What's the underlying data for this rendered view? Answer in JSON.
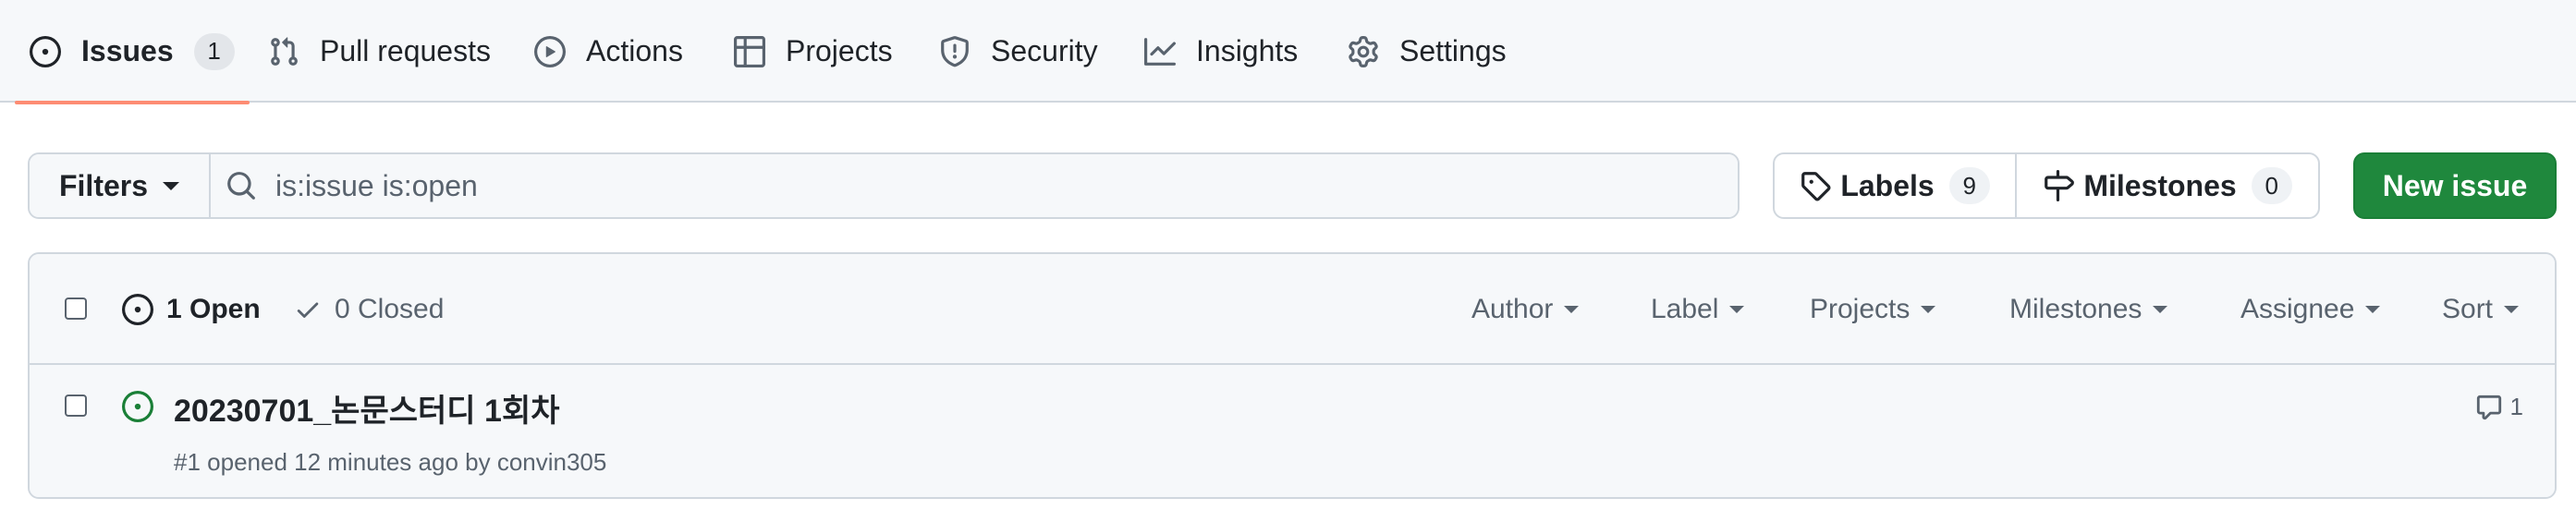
{
  "nav": {
    "issues": {
      "label": "Issues",
      "count": "1"
    },
    "pull_requests": "Pull requests",
    "actions": "Actions",
    "projects": "Projects",
    "security": "Security",
    "insights": "Insights",
    "settings": "Settings"
  },
  "subnav": {
    "filters_label": "Filters",
    "search_value": "is:issue is:open",
    "labels_label": "Labels",
    "labels_count": "9",
    "milestones_label": "Milestones",
    "milestones_count": "0",
    "new_issue_label": "New issue"
  },
  "list_header": {
    "open_label": "1 Open",
    "closed_label": "0 Closed",
    "filters": [
      "Author",
      "Label",
      "Projects",
      "Milestones",
      "Assignee",
      "Sort"
    ]
  },
  "issues": [
    {
      "title": "20230701_논문스터디 1회차",
      "meta": "#1 opened 12 minutes ago by convin305",
      "comments": "1"
    }
  ],
  "colors": {
    "accent_underline": "#fd8c73",
    "primary_button": "#1f883d",
    "open_state": "#1a7f37",
    "muted_text": "#59636e"
  }
}
